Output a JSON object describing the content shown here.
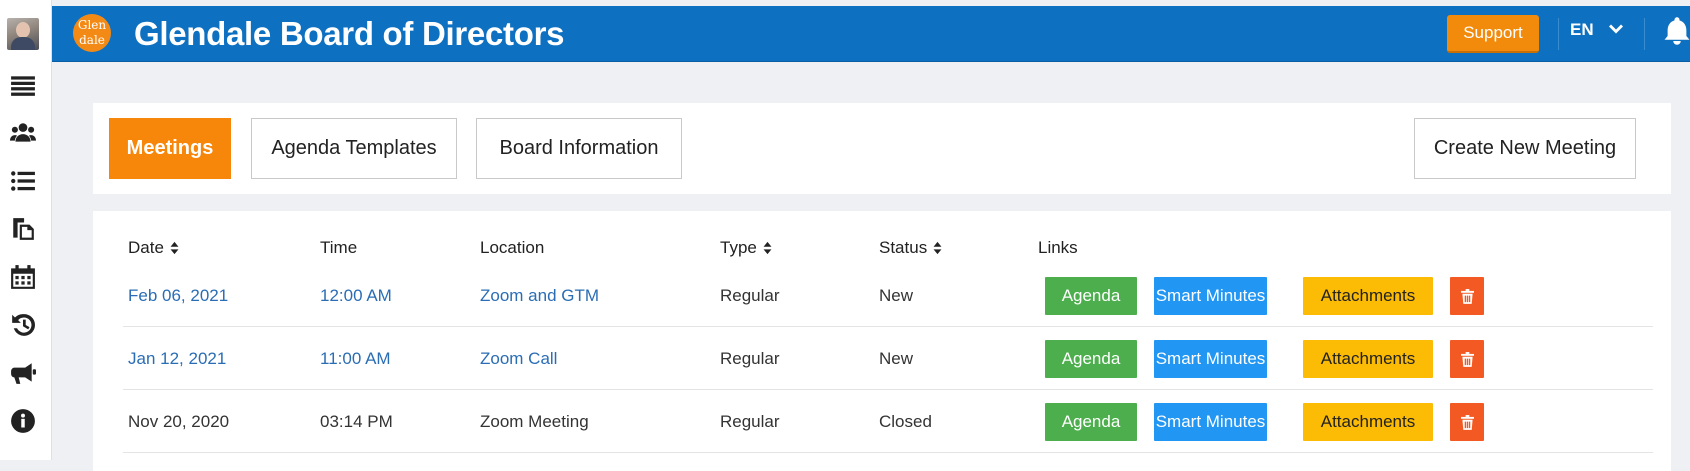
{
  "header": {
    "logo_text": "Glen dale",
    "title": "Glendale Board of Directors",
    "support_label": "Support",
    "language": "EN",
    "brand_color": "#0e70c0",
    "accent_color": "#f7870b"
  },
  "sidebar": {
    "avatar_alt": "user-avatar",
    "items": [
      {
        "icon": "menu-bars-icon"
      },
      {
        "icon": "users-icon"
      },
      {
        "icon": "list-icon"
      },
      {
        "icon": "documents-icon"
      },
      {
        "icon": "calendar-icon"
      },
      {
        "icon": "history-icon"
      },
      {
        "icon": "megaphone-icon"
      },
      {
        "icon": "info-icon"
      }
    ]
  },
  "tabs": {
    "meetings": "Meetings",
    "agenda_templates": "Agenda Templates",
    "board_information": "Board Information",
    "create_new_meeting": "Create New Meeting"
  },
  "table": {
    "columns": {
      "date": "Date",
      "time": "Time",
      "location": "Location",
      "type": "Type",
      "status": "Status",
      "links": "Links"
    },
    "buttons": {
      "agenda": "Agenda",
      "smart_minutes": "Smart Minutes",
      "attachments": "Attachments",
      "delete_icon": "trash-icon"
    },
    "rows": [
      {
        "date": "Feb 06, 2021",
        "time": "12:00 AM",
        "location": "Zoom and GTM",
        "type": "Regular",
        "status": "New",
        "linked": true
      },
      {
        "date": "Jan 12, 2021",
        "time": "11:00 AM",
        "location": "Zoom Call",
        "type": "Regular",
        "status": "New",
        "linked": true
      },
      {
        "date": "Nov 20, 2020",
        "time": "03:14 PM",
        "location": "Zoom Meeting",
        "type": "Regular",
        "status": "Closed",
        "linked": false
      }
    ]
  }
}
